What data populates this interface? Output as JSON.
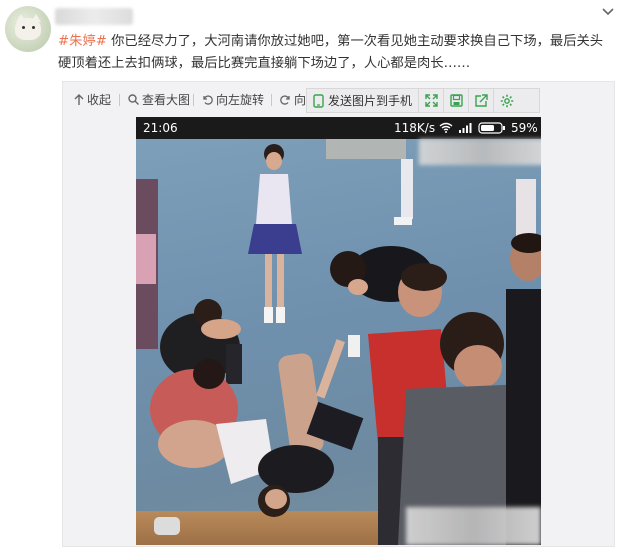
{
  "post": {
    "topic": "#朱婷#",
    "body": " 你已经尽力了，大河南请你放过她吧，第一次看见她主动要求换自己下场，最后关头硬顶着还上去扣俩球，最后比赛完直接躺下场边了，人心都是肉长……"
  },
  "toolbar": {
    "collapse_label": "收起",
    "view_large_label": "查看大图",
    "rotate_left_label": "向左旋转",
    "rotate_right_label": "向"
  },
  "sendbar": {
    "send_label": "发送图片到手机"
  },
  "phone_status": {
    "time": "21:06",
    "speed": "118K/s",
    "battery": "59%"
  },
  "colors": {
    "topic": "#eb7350",
    "send_icons": "#3aa34f",
    "text": "#333333"
  }
}
